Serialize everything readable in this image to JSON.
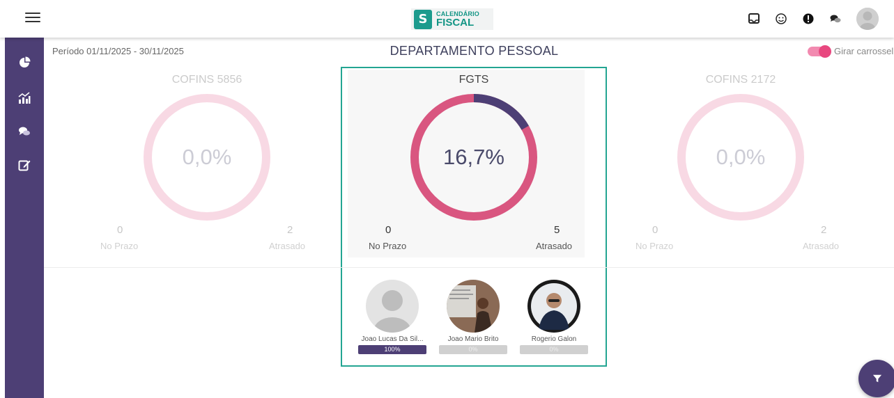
{
  "header": {
    "logo_line1": "CALENDÁRIO",
    "logo_line2": "FISCAL",
    "logo_mark": "S"
  },
  "top_icons": [
    "inbox-icon",
    "smiley-icon",
    "alert-icon",
    "chat-icon",
    "user-avatar"
  ],
  "sidebar": {
    "items": [
      "pie-chart-icon",
      "bar-chart-icon",
      "comments-icon",
      "edit-icon"
    ]
  },
  "page": {
    "periodo": "Período 01/11/2025 - 30/11/2025",
    "title": "DEPARTAMENTO PESSOAL",
    "toggle_label": "Girar carrossel",
    "toggle_on": true
  },
  "cards": [
    {
      "title": "COFINS 5856",
      "percent": "0,0%",
      "no_prazo_value": "0",
      "no_prazo_label": "No Prazo",
      "atrasado_value": "2",
      "atrasado_label": "Atrasado"
    },
    {
      "title": "FGTS",
      "percent": "16,7%",
      "no_prazo_value": "0",
      "no_prazo_label": "No Prazo",
      "atrasado_value": "5",
      "atrasado_label": "Atrasado"
    },
    {
      "title": "COFINS 2172",
      "percent": "0,0%",
      "no_prazo_value": "0",
      "no_prazo_label": "No Prazo",
      "atrasado_value": "2",
      "atrasado_label": "Atrasado"
    }
  ],
  "donut_fraction": [
    0,
    0.167,
    0
  ],
  "colors": {
    "accent": "#4d3f75",
    "late": "#d95680",
    "focus_border": "#23a592",
    "faded": "#f0c3d2"
  },
  "people": [
    {
      "name": "Joao Lucas Da Sil...",
      "progress": "100%",
      "progress_value": 1.0
    },
    {
      "name": "Joao Mario Brito",
      "progress": "0%",
      "progress_value": 0
    },
    {
      "name": "Rogerio Galon",
      "progress": "0%",
      "progress_value": 0
    }
  ]
}
